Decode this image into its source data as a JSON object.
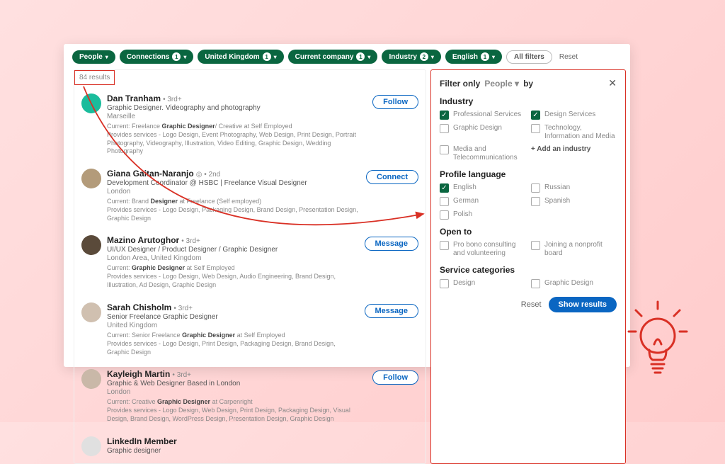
{
  "pills": [
    {
      "label": "People",
      "badge": null
    },
    {
      "label": "Connections",
      "badge": "1"
    },
    {
      "label": "United Kingdom",
      "badge": "1"
    },
    {
      "label": "Current company",
      "badge": "1"
    },
    {
      "label": "Industry",
      "badge": "2"
    },
    {
      "label": "English",
      "badge": "1"
    }
  ],
  "allFilters": "All filters",
  "resetTop": "Reset",
  "resultsCount": "84 results",
  "results": [
    {
      "name": "Dan Tranham",
      "degree": "• 3rd+",
      "title": "Graphic Designer. Videography and photography",
      "loc": "Marseille",
      "current": "Current: Freelance Graphic Designer/ Creative at Self Employed",
      "services": "Provides services - Logo Design, Event Photography, Web Design, Print Design, Portrait Photography, Videography, Illustration, Video Editing, Graphic Design, Wedding Photography",
      "action": "Follow",
      "avatarBg": "#1abc9c"
    },
    {
      "name": "Giana Gaitan-Naranjo",
      "degree": "◎ • 2nd",
      "title": "Development Coordinator @ HSBC | Freelance Visual Designer",
      "loc": "London",
      "current": "Current: Brand Designer at Freelance (Self employed)",
      "services": "Provides services - Logo Design, Packaging Design, Brand Design, Presentation Design, Graphic Design",
      "action": "Connect",
      "avatarBg": "#b39b7a"
    },
    {
      "name": "Mazino Arutoghor",
      "degree": "• 3rd+",
      "title": "UI/UX Designer / Product Designer / Graphic Designer",
      "loc": "London Area, United Kingdom",
      "current": "Current: Graphic Designer at Self Employed",
      "services": "Provides services - Logo Design, Web Design, Audio Engineering, Brand Design, Illustration, Ad Design, Graphic Design",
      "action": "Message",
      "avatarBg": "#5a4a3a"
    },
    {
      "name": "Sarah Chisholm",
      "degree": "• 3rd+",
      "title": "Senior Freelance Graphic Designer",
      "loc": "United Kingdom",
      "current": "Current: Senior Freelance Graphic Designer at Self Employed",
      "services": "Provides services - Logo Design, Print Design, Packaging Design, Brand Design, Graphic Design",
      "action": "Message",
      "avatarBg": "#d0c0b0"
    },
    {
      "name": "Kayleigh Martin",
      "degree": "• 3rd+",
      "title": "Graphic & Web Designer Based in London",
      "loc": "London",
      "current": "Current: Creative Graphic Designer at Carpenright",
      "services": "Provides services - Logo Design, Web Design, Print Design, Packaging Design, Visual Design, Brand Design, WordPress Design, Presentation Design, Graphic Design",
      "action": "Follow",
      "avatarBg": "#c9b8a8"
    },
    {
      "name": "LinkedIn Member",
      "degree": "",
      "title": "Graphic designer",
      "loc": "",
      "current": "",
      "services": "",
      "action": "",
      "avatarBg": "#e0e0e0"
    }
  ],
  "filterPanel": {
    "title": "Filter only",
    "dropdown": "People",
    "by": "by",
    "sections": {
      "industry": {
        "heading": "Industry",
        "opts": [
          {
            "label": "Professional Services",
            "checked": true
          },
          {
            "label": "Design Services",
            "checked": true
          },
          {
            "label": "Graphic Design",
            "checked": false
          },
          {
            "label": "Technology, Information and Media",
            "checked": false
          },
          {
            "label": "Media and Telecommunications",
            "checked": false
          }
        ],
        "add": "+ Add an industry"
      },
      "lang": {
        "heading": "Profile language",
        "opts": [
          {
            "label": "English",
            "checked": true
          },
          {
            "label": "Russian",
            "checked": false
          },
          {
            "label": "German",
            "checked": false
          },
          {
            "label": "Spanish",
            "checked": false
          },
          {
            "label": "Polish",
            "checked": false
          }
        ]
      },
      "open": {
        "heading": "Open to",
        "opts": [
          {
            "label": "Pro bono consulting and volunteering",
            "checked": false
          },
          {
            "label": "Joining a nonprofit board",
            "checked": false
          }
        ]
      },
      "service": {
        "heading": "Service categories",
        "opts": [
          {
            "label": "Design",
            "checked": false
          },
          {
            "label": "Graphic Design",
            "checked": false
          }
        ]
      }
    },
    "reset": "Reset",
    "show": "Show results"
  }
}
